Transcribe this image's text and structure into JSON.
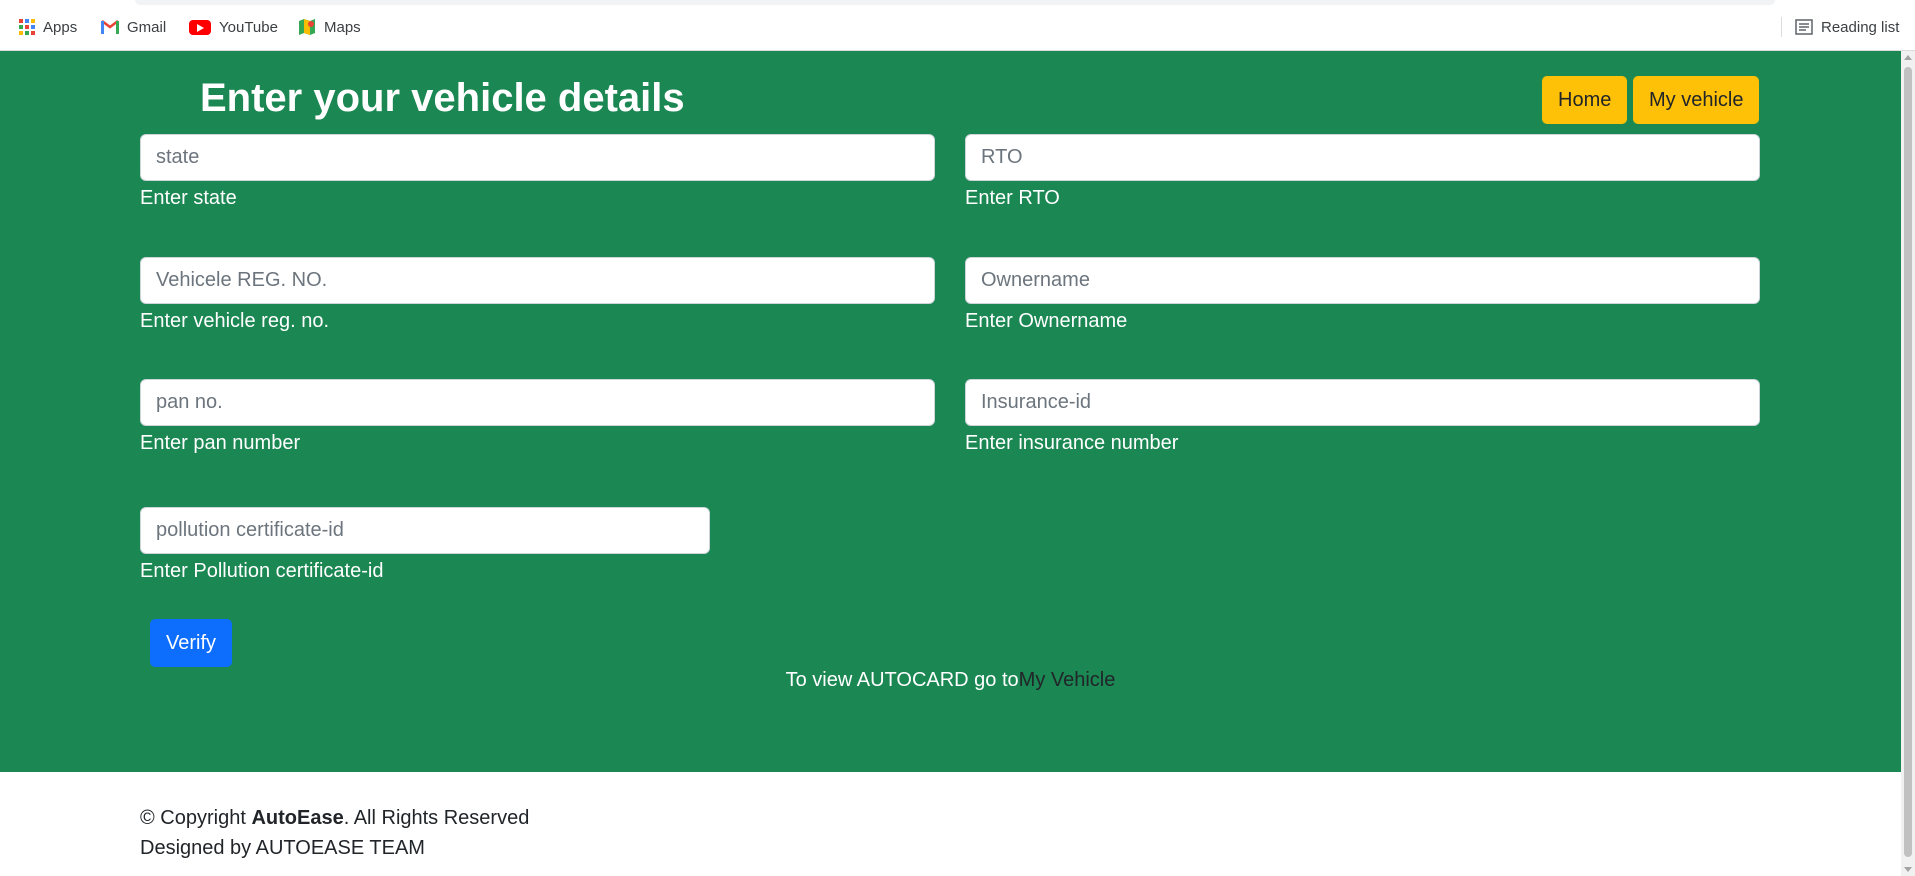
{
  "bookmarks": {
    "apps": "Apps",
    "gmail": "Gmail",
    "youtube": "YouTube",
    "maps": "Maps",
    "reading_list": "Reading list"
  },
  "header": {
    "title": "Enter your vehicle details",
    "home_label": "Home",
    "my_vehicle_label": "My vehicle"
  },
  "form": {
    "state": {
      "placeholder": "state",
      "label": "Enter state",
      "value": ""
    },
    "rto": {
      "placeholder": "RTO",
      "label": "Enter RTO",
      "value": ""
    },
    "reg_no": {
      "placeholder": "Vehicele REG. NO.",
      "label": "Enter vehicle reg. no.",
      "value": ""
    },
    "owner": {
      "placeholder": "Ownername",
      "label": "Enter Ownername",
      "value": ""
    },
    "pan": {
      "placeholder": "pan no.",
      "label": "Enter pan number",
      "value": ""
    },
    "insurance": {
      "placeholder": "Insurance-id",
      "label": "Enter insurance number",
      "value": ""
    },
    "pollution": {
      "placeholder": "pollution certificate-id",
      "label": "Enter Pollution certificate-id",
      "value": ""
    },
    "verify_label": "Verify"
  },
  "autocard": {
    "text": "To view AUTOCARD go to",
    "link": "My Vehicle"
  },
  "footer": {
    "copyright_prefix": "© Copyright ",
    "brand": "AutoEase",
    "copyright_suffix": ". All Rights Reserved",
    "designed_by": "Designed by AUTOEASE TEAM"
  },
  "colors": {
    "main_bg": "#1b8753",
    "nav_button": "#ffc107",
    "verify_button": "#0d6efd"
  },
  "icons": [
    "apps-grid-icon",
    "gmail-icon",
    "youtube-icon",
    "maps-icon",
    "reading-list-icon"
  ]
}
